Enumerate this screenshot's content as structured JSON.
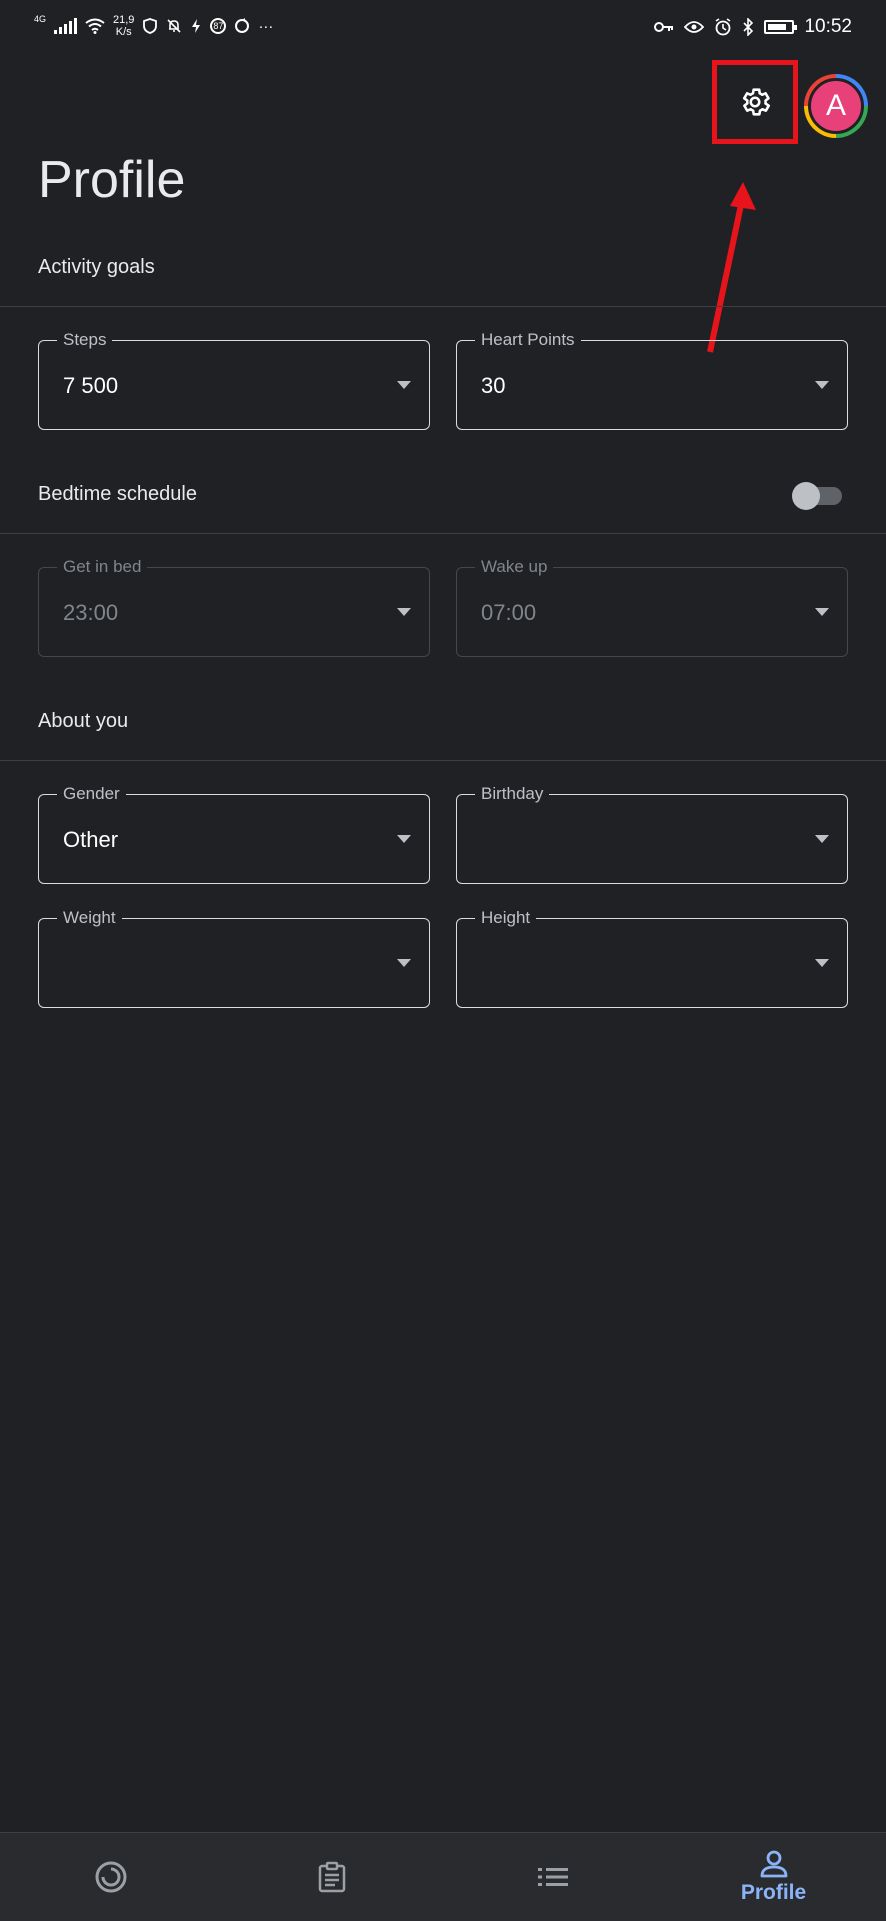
{
  "status_bar": {
    "network_type": "4G",
    "speed_value": "21,9",
    "speed_unit": "K/s",
    "badge_count": "87",
    "more": "···",
    "time": "10:52"
  },
  "header": {
    "title": "Profile",
    "avatar_letter": "A"
  },
  "activity_goals": {
    "title": "Activity goals",
    "steps": {
      "label": "Steps",
      "value": "7 500"
    },
    "heart_points": {
      "label": "Heart Points",
      "value": "30"
    }
  },
  "bedtime": {
    "title": "Bedtime schedule",
    "toggle_on": false,
    "get_in_bed": {
      "label": "Get in bed",
      "value": "23:00"
    },
    "wake_up": {
      "label": "Wake up",
      "value": "07:00"
    }
  },
  "about_you": {
    "title": "About you",
    "gender": {
      "label": "Gender",
      "value": "Other"
    },
    "birthday": {
      "label": "Birthday",
      "value": ""
    },
    "weight": {
      "label": "Weight",
      "value": ""
    },
    "height": {
      "label": "Height",
      "value": ""
    }
  },
  "bottom_nav": {
    "items": [
      {
        "icon": "home-ring-icon",
        "label": ""
      },
      {
        "icon": "journal-icon",
        "label": ""
      },
      {
        "icon": "browse-list-icon",
        "label": ""
      },
      {
        "icon": "profile-icon",
        "label": "Profile",
        "active": true
      }
    ]
  },
  "colors": {
    "background": "#202124",
    "accent": "#8ab4f8",
    "highlight_box": "#e8141b",
    "avatar": "#e8417a"
  }
}
